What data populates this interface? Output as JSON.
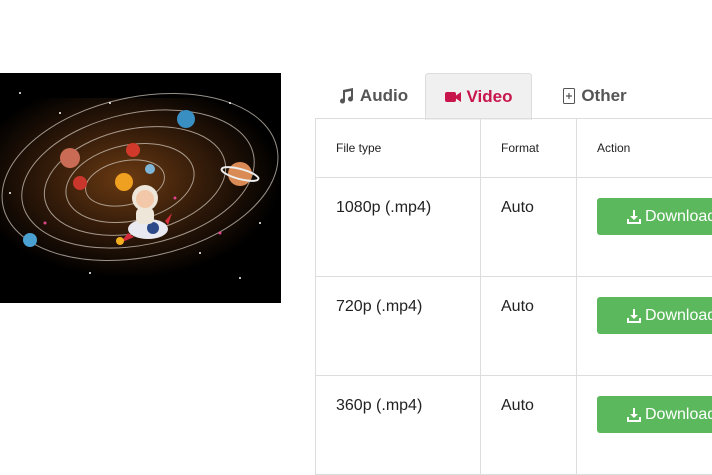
{
  "tabs": [
    {
      "label": "Audio",
      "icon": "music-note-icon"
    },
    {
      "label": "Video",
      "icon": "video-camera-icon",
      "active": true,
      "color": "#c8154b"
    },
    {
      "label": "Other",
      "icon": "file-plus-icon"
    }
  ],
  "table": {
    "headers": [
      "File type",
      "Format",
      "Action"
    ],
    "rows": [
      {
        "file_type": "1080p (.mp4)",
        "format": "Auto",
        "action": "Download"
      },
      {
        "file_type": "720p (.mp4)",
        "format": "Auto",
        "action": "Download"
      },
      {
        "file_type": "360p (.mp4)",
        "format": "Auto",
        "action": "Download"
      }
    ]
  },
  "colors": {
    "download_button": "#5cb85c",
    "active_tab": "#c8154b"
  }
}
